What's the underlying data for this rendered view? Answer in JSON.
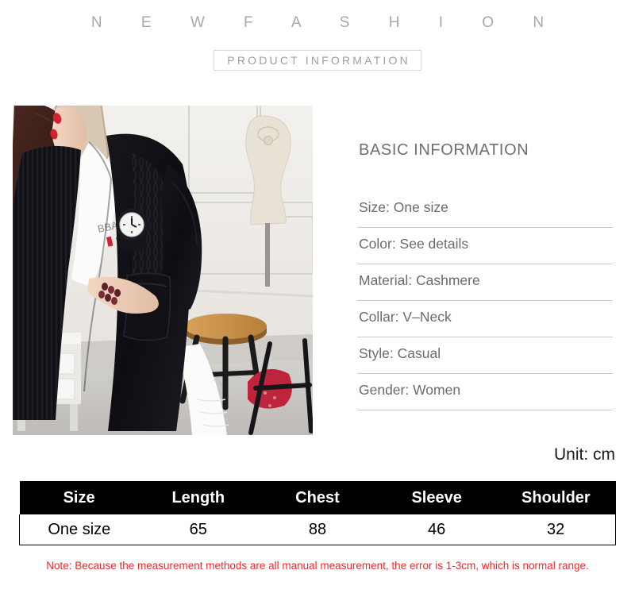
{
  "header": {
    "brand": "N E W   F A S H I O N",
    "subtitle": "PRODUCT INFORMATION"
  },
  "photo": {
    "alt": "model-wearing-black-long-cardigan"
  },
  "basic_information": {
    "heading": "BASIC INFORMATION",
    "specs": [
      "Size: One size",
      "Color: See details",
      "Material: Cashmere",
      "Collar: V–Neck",
      "Style: Casual",
      "Gender: Women"
    ]
  },
  "size_chart": {
    "unit_label": "Unit: cm",
    "columns": [
      "Size",
      "Length",
      "Chest",
      "Sleeve",
      "Shoulder"
    ],
    "rows": [
      [
        "One size",
        "65",
        "88",
        "46",
        "32"
      ]
    ],
    "note": "Note: Because the measurement methods are all manual measurement, the error is 1-3cm, which is normal range."
  },
  "colors": {
    "brand_gray": "#a9a9a9",
    "text_gray": "#6b6b6b",
    "table_header_bg": "#000000",
    "note_red": "#ef2a2a"
  }
}
